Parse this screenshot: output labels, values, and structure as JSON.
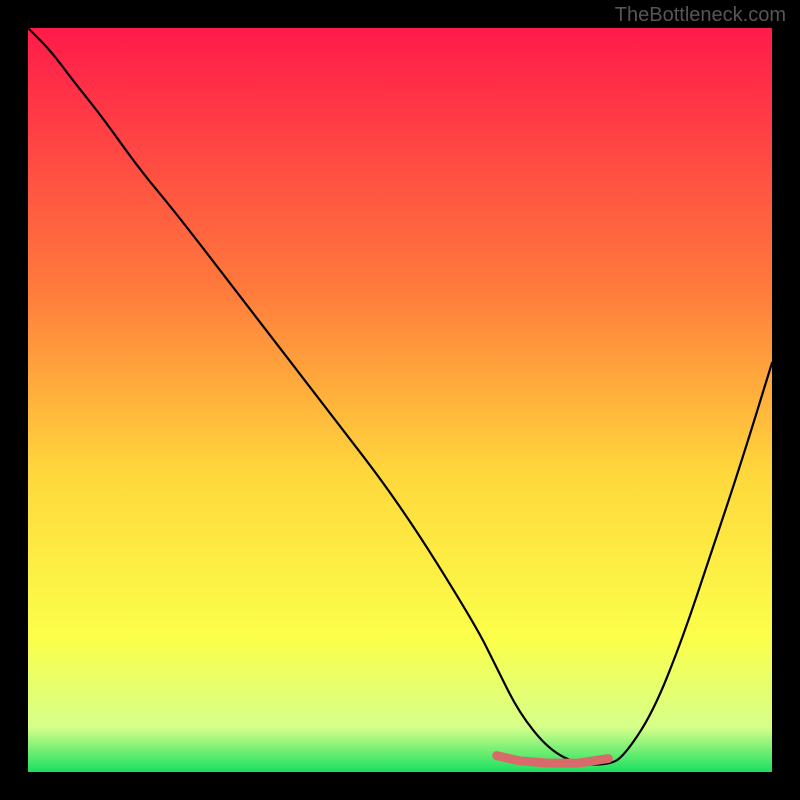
{
  "watermark": "TheBottleneck.com",
  "chart_data": {
    "type": "line",
    "title": "",
    "xlabel": "",
    "ylabel": "",
    "xlim": [
      0,
      100
    ],
    "ylim": [
      0,
      100
    ],
    "gradient_stops": [
      {
        "offset": 0,
        "color": "#ff1a4a"
      },
      {
        "offset": 35,
        "color": "#ff7a3c"
      },
      {
        "offset": 60,
        "color": "#ffd83c"
      },
      {
        "offset": 82,
        "color": "#fbff4a"
      },
      {
        "offset": 94,
        "color": "#d6ff8a"
      },
      {
        "offset": 100,
        "color": "#18e060"
      }
    ],
    "series": [
      {
        "name": "main-curve",
        "color": "#000000",
        "x": [
          0,
          3,
          6,
          10,
          15,
          20,
          30,
          40,
          50,
          60,
          63,
          66,
          70,
          74,
          78,
          80,
          84,
          88,
          92,
          96,
          100
        ],
        "y": [
          100,
          97,
          93,
          88,
          81,
          75,
          62,
          49,
          36,
          20,
          14,
          8,
          3,
          1,
          1,
          2,
          8,
          18,
          30,
          42,
          55
        ]
      },
      {
        "name": "highlight-band",
        "color": "#d96a6a",
        "x": [
          63,
          66,
          70,
          74,
          78
        ],
        "y": [
          2.2,
          1.5,
          1.2,
          1.2,
          1.8
        ]
      }
    ]
  }
}
